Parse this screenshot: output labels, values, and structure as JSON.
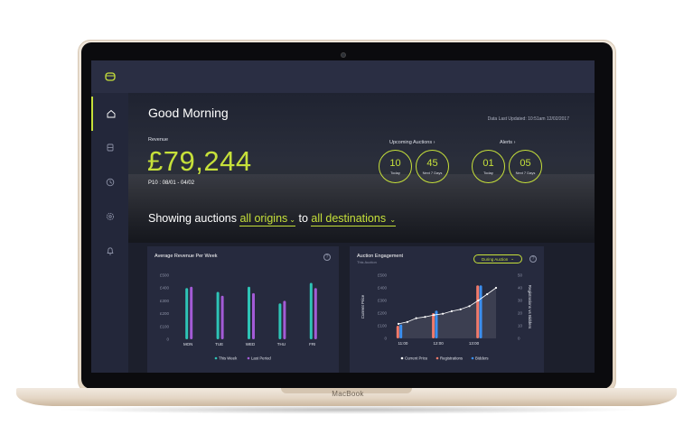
{
  "device": {
    "brand_label": "MacBook"
  },
  "sidebar": {
    "items": [
      {
        "icon": "home-icon",
        "active": true
      },
      {
        "icon": "auction-icon",
        "active": false
      },
      {
        "icon": "history-icon",
        "active": false
      },
      {
        "icon": "settings-icon",
        "active": false
      },
      {
        "icon": "bell-icon",
        "active": false
      }
    ]
  },
  "header": {
    "greeting": "Good Morning",
    "data_updated": "Data Last Updated:  10:51am 12/02/2017"
  },
  "revenue": {
    "label": "Revenue",
    "value": "£79,244",
    "period": "P10 :  08/01 - 04/02"
  },
  "upcoming": {
    "label": "Upcoming Auctions  ›",
    "today": {
      "value": "10",
      "label": "Today"
    },
    "next7": {
      "value": "45",
      "label": "Next 7 Days"
    }
  },
  "alerts": {
    "label": "Alerts  ›",
    "today": {
      "value": "01",
      "label": "Today"
    },
    "next7": {
      "value": "05",
      "label": "Next 7 Days"
    }
  },
  "filter": {
    "prefix": "Showing auctions",
    "origins": "all origins",
    "to": "to",
    "destinations": "all destinations"
  },
  "colors": {
    "accent": "#c6e03a",
    "teal": "#2ec4b6",
    "purple": "#a35bd6",
    "pink": "#f07a6a",
    "blue": "#3b8ff0"
  },
  "chart_data": [
    {
      "type": "bar",
      "title": "Average Revenue Per Week",
      "categories": [
        "MON",
        "TUE",
        "WED",
        "THU",
        "FRI"
      ],
      "ylim": [
        0,
        500
      ],
      "yticks": [
        "£500",
        "£400",
        "£300",
        "£200",
        "£100",
        "0"
      ],
      "series": [
        {
          "name": "This Week",
          "values": [
            400,
            370,
            410,
            280,
            440
          ]
        },
        {
          "name": "Last Period",
          "values": [
            410,
            340,
            360,
            300,
            400
          ]
        }
      ]
    },
    {
      "type": "line",
      "title": "Auction Engagement",
      "subtitle": "This  Auction",
      "dropdown": "During Auction",
      "ylabel": "Current Price",
      "y2label": "Registrations vs Bidders",
      "ylim": [
        0,
        500
      ],
      "yticks": [
        "£500",
        "£400",
        "£300",
        "£200",
        "£100",
        "0"
      ],
      "y2ticks": [
        "50",
        "40",
        "30",
        "20",
        "10",
        "0"
      ],
      "xticks": [
        "11:00",
        "12:00",
        "13:00"
      ],
      "line": {
        "name": "Current Price",
        "points": [
          [
            0,
            115
          ],
          [
            1,
            130
          ],
          [
            2,
            160
          ],
          [
            3,
            170
          ],
          [
            4,
            185
          ],
          [
            5,
            195
          ],
          [
            6,
            215
          ],
          [
            7,
            230
          ],
          [
            8,
            255
          ],
          [
            9,
            300
          ],
          [
            10,
            350
          ],
          [
            11,
            400
          ]
        ]
      },
      "bars": [
        {
          "x": 0,
          "name": "Registrations",
          "value": 10
        },
        {
          "x": 0,
          "name": "Bidders",
          "value": 11
        },
        {
          "x": 4,
          "name": "Registrations",
          "value": 20
        },
        {
          "x": 4,
          "name": "Bidders",
          "value": 22
        },
        {
          "x": 9,
          "name": "Registrations",
          "value": 42
        },
        {
          "x": 9,
          "name": "Bidders",
          "value": 42
        }
      ],
      "legend": [
        "Current Price",
        "Registrations",
        "Bidders"
      ]
    }
  ]
}
